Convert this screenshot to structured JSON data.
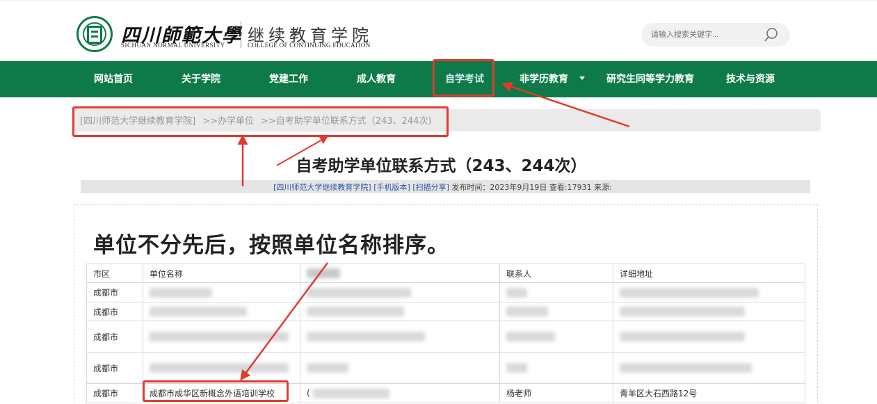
{
  "header": {
    "university_cn": "四川師範大學",
    "university_en": "SICHUAN NORMAL UNIVERSITY",
    "college_cn": "继续教育学院",
    "college_en": "COLLEGE OF CONTINUING EDUCATION",
    "search_placeholder": "请输入搜索关键字..."
  },
  "nav": {
    "items": [
      {
        "label": "网站首页"
      },
      {
        "label": "关于学院"
      },
      {
        "label": "党建工作"
      },
      {
        "label": "成人教育"
      },
      {
        "label": "自学考试"
      },
      {
        "label": "非学历教育"
      },
      {
        "label": "研究生同等学力教育"
      },
      {
        "label": "技术与资源"
      }
    ]
  },
  "breadcrumb": [
    "[四川师范大学继续教育学院]",
    ">>办学单位",
    ">>自考助学单位联系方式（243、244次)"
  ],
  "article": {
    "title": "自考助学单位联系方式（243、244次）",
    "meta": {
      "source": "[四川师范大学继续教育学院]",
      "mobile": "[手机版本]",
      "share": "[扫描分享]",
      "published": "发布时间：2023年9月19日",
      "views": "查看:17931",
      "origin": "来源:"
    },
    "lead": "单位不分先后，按照单位名称排序。"
  },
  "table": {
    "headers": [
      "市区",
      "单位名称",
      "",
      "联系人",
      "详细地址"
    ],
    "rows": [
      {
        "city": "成都市"
      },
      {
        "city": "成都市"
      },
      {
        "city": "成都市"
      },
      {
        "city": "成都市"
      },
      {
        "city": "成都市",
        "name": "成都市成华区新概念外语培训学校",
        "phone": "(",
        "contact": "杨老师",
        "address": "青羊区大石西路12号"
      }
    ]
  },
  "colors": {
    "brand_green": "#0e7a4a",
    "annotation_red": "#e23a2e"
  }
}
